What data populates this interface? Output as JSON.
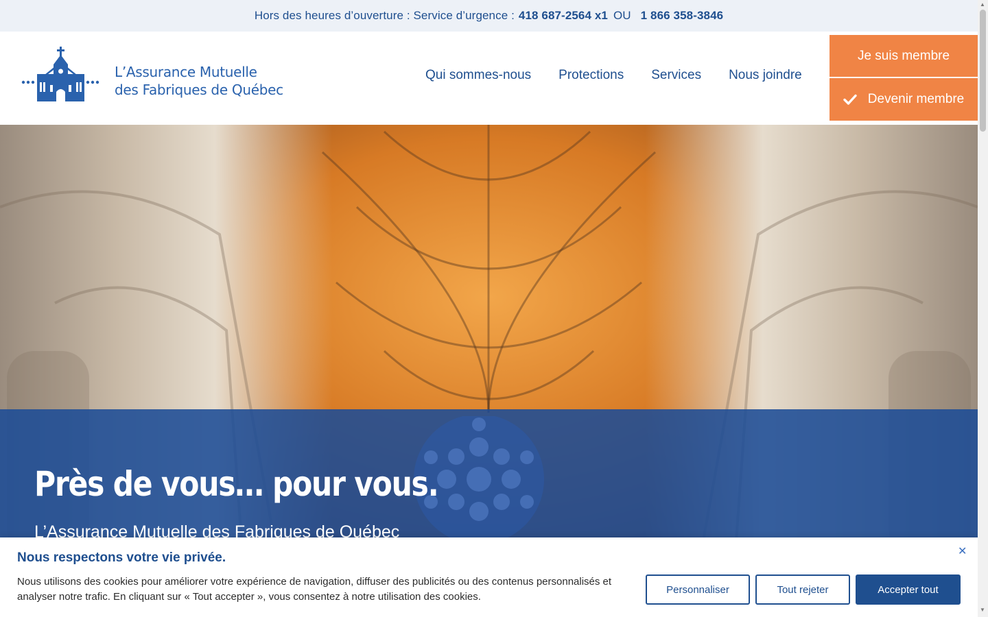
{
  "topbar": {
    "text": "Hors des heures d’ouverture : Service d’urgence :",
    "phone1": "418 687-2564 x1",
    "separator": "OU",
    "phone2": "1 866 358-3846"
  },
  "header": {
    "logo_line1": "L’Assurance Mutuelle",
    "logo_line2": "des Fabriques de Québec",
    "nav": [
      "Qui sommes-nous",
      "Protections",
      "Services",
      "Nous joindre"
    ],
    "btn_membre": "Je suis membre",
    "btn_devenir": "Devenir membre"
  },
  "hero": {
    "title": "Près de vous… pour vous.",
    "subtitle": "L’Assurance Mutuelle des Fabriques de Québec"
  },
  "cookie": {
    "title": "Nous respectons votre vie privée.",
    "text": "Nous utilisons des cookies pour améliorer votre expérience de navigation, diffuser des publicités ou des contenus personnalisés et analyser notre trafic. En cliquant sur « Tout accepter », vous consentez à notre utilisation des cookies.",
    "btn_personnaliser": "Personnaliser",
    "btn_rejeter": "Tout rejeter",
    "btn_accepter": "Accepter tout",
    "close": "✕"
  },
  "colors": {
    "brand_blue": "#1f4f8f",
    "accent_orange": "#f08445",
    "topbar_bg": "#edf1f7"
  },
  "icons": [
    "church-logo-icon",
    "check-icon",
    "close-icon"
  ]
}
